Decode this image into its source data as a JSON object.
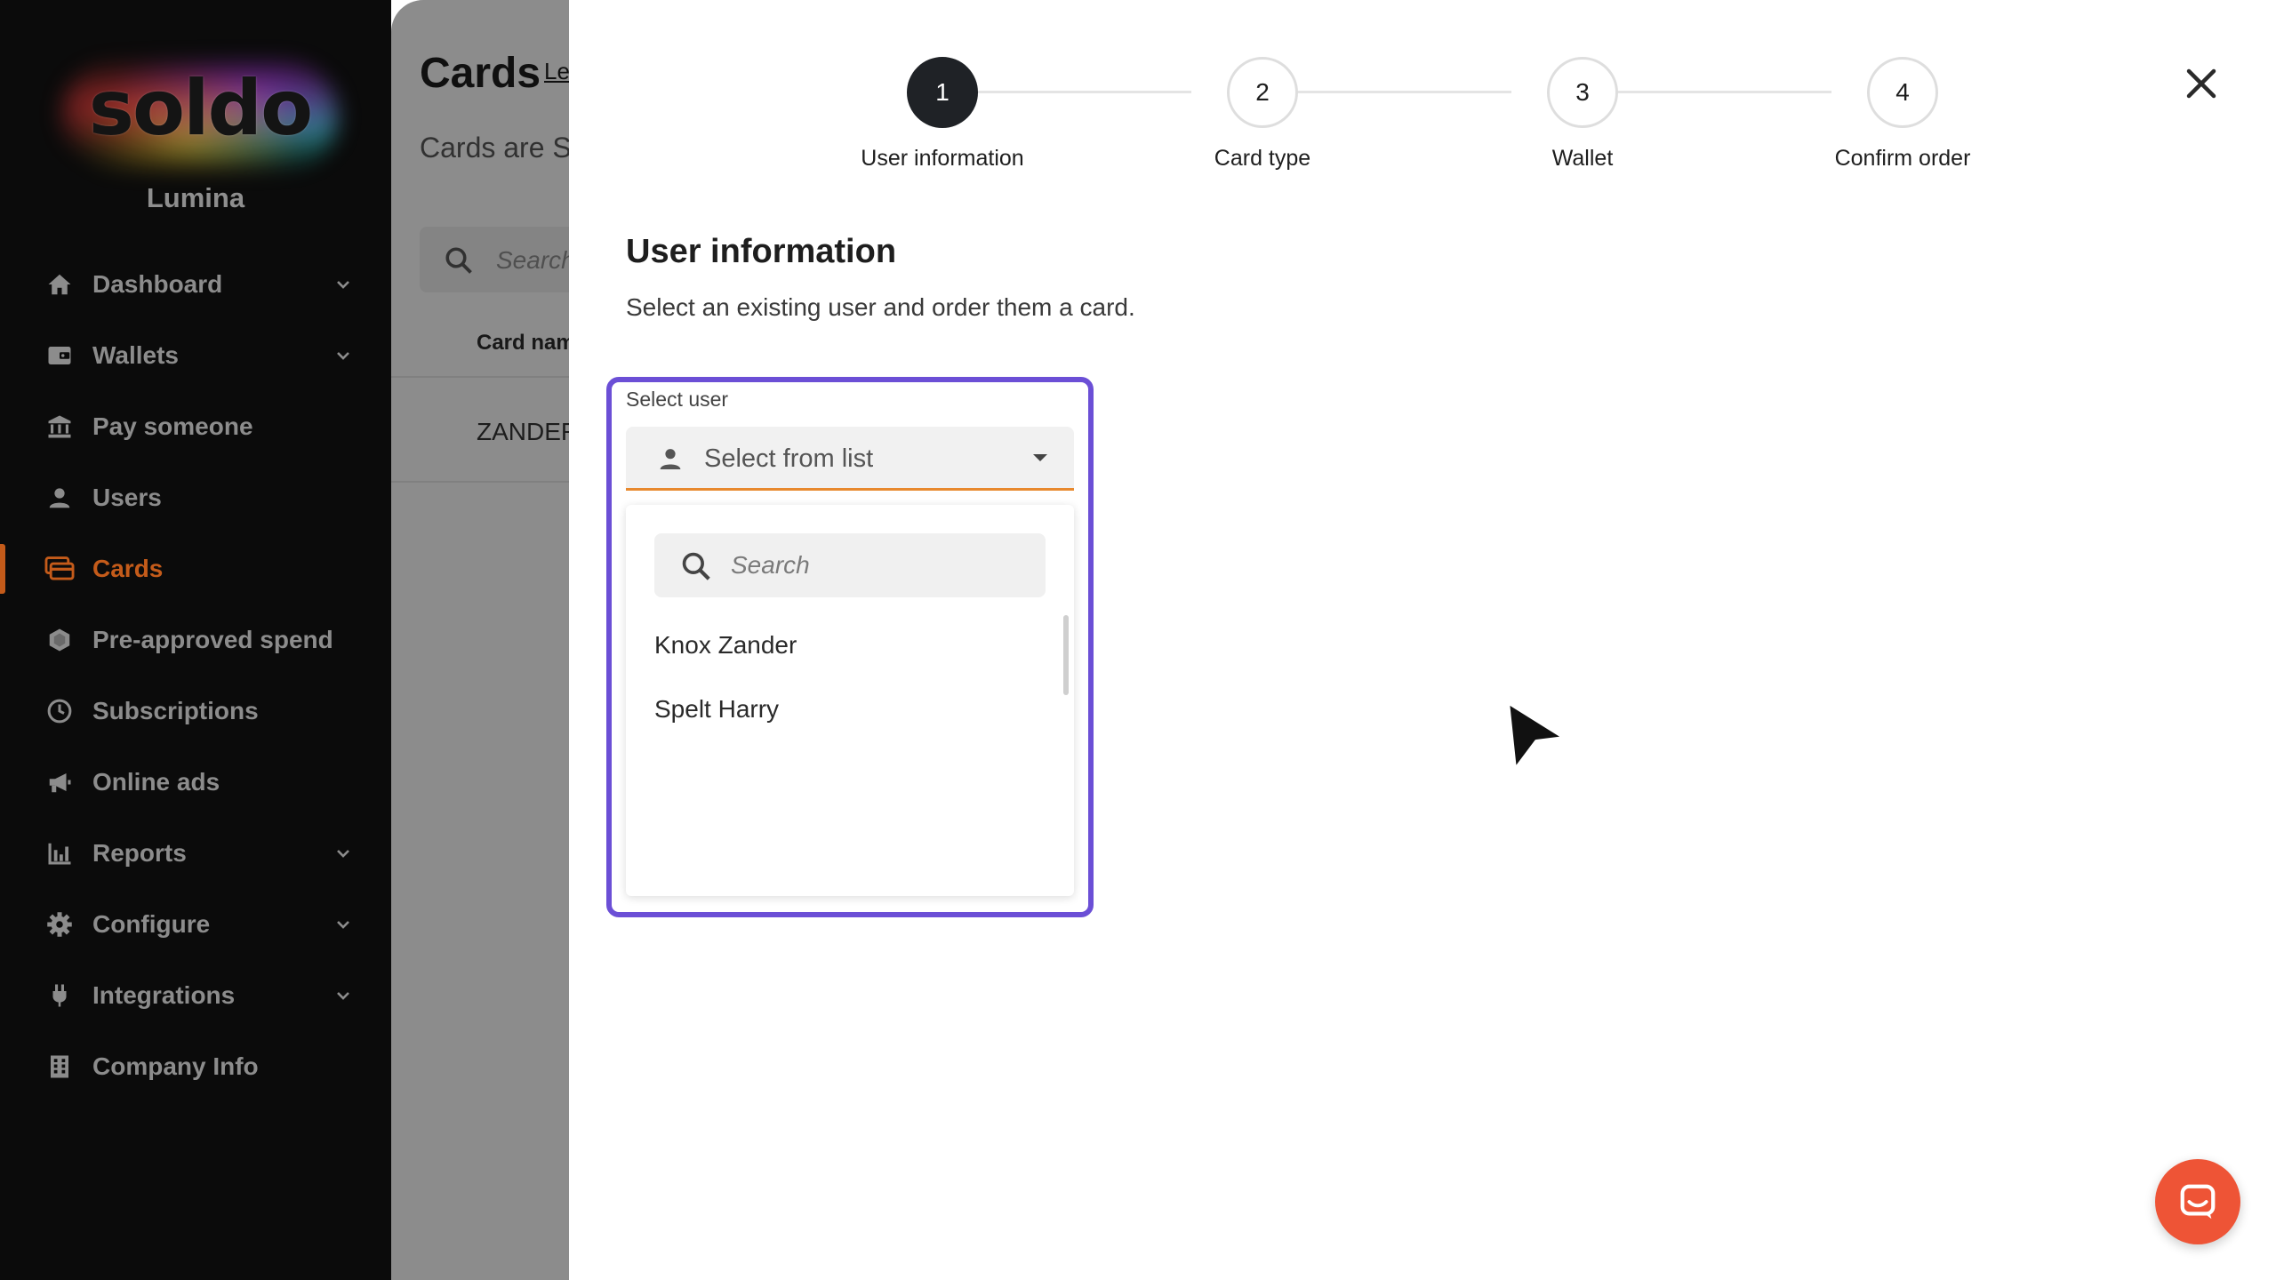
{
  "app": {
    "logo_text": "soldo",
    "org_name": "Lumina"
  },
  "sidebar": {
    "items": [
      {
        "label": "Dashboard",
        "icon": "home-icon",
        "has_chevron": true
      },
      {
        "label": "Wallets",
        "icon": "wallet-icon",
        "has_chevron": true
      },
      {
        "label": "Pay someone",
        "icon": "bank-icon",
        "has_chevron": false
      },
      {
        "label": "Users",
        "icon": "user-icon",
        "has_chevron": false
      },
      {
        "label": "Cards",
        "icon": "cards-icon",
        "has_chevron": false,
        "active": true
      },
      {
        "label": "Pre-approved spend",
        "icon": "hexagon-icon",
        "has_chevron": false
      },
      {
        "label": "Subscriptions",
        "icon": "clock-icon",
        "has_chevron": false
      },
      {
        "label": "Online ads",
        "icon": "megaphone-icon",
        "has_chevron": false
      },
      {
        "label": "Reports",
        "icon": "bar-chart-icon",
        "has_chevron": true
      },
      {
        "label": "Configure",
        "icon": "gear-icon",
        "has_chevron": true
      },
      {
        "label": "Integrations",
        "icon": "plug-icon",
        "has_chevron": true
      },
      {
        "label": "Company Info",
        "icon": "building-icon",
        "has_chevron": false
      }
    ],
    "active_color": "#c45b1a"
  },
  "background_page": {
    "title": "Cards",
    "title_link": "Le",
    "subtitle": "Cards are So",
    "search_placeholder": "Search",
    "column_header": "Card nam",
    "row_value": "ZANDER"
  },
  "stepper": {
    "steps": [
      {
        "number": "1",
        "label": "User information",
        "active": true
      },
      {
        "number": "2",
        "label": "Card type",
        "active": false
      },
      {
        "number": "3",
        "label": "Wallet",
        "active": false
      },
      {
        "number": "4",
        "label": "Confirm order",
        "active": false
      }
    ]
  },
  "form": {
    "title": "User information",
    "description": "Select an existing user and order them a card.",
    "field_label": "Select user",
    "select_value": "Select from list",
    "dropdown": {
      "search_placeholder": "Search",
      "options": [
        "Knox Zander",
        "Spelt Harry"
      ]
    }
  },
  "colors": {
    "highlight": "#6b4fd6",
    "select_underline": "#e8892e",
    "chat_button": "#ee5436",
    "active_step": "#1f2226"
  }
}
